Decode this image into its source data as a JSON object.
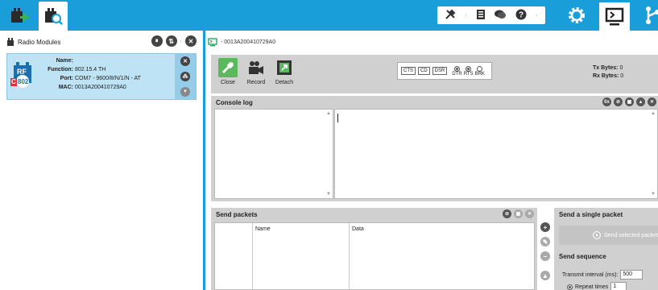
{
  "colors": {
    "accent": "#1a9ed9",
    "panel": "#d0d0d0",
    "card": "#bde3f5"
  },
  "left_panel": {
    "title": "Radio Modules",
    "module": {
      "name_label": "Name:",
      "name_value": "",
      "function_label": "Function:",
      "function_value": "802.15.4 TH",
      "port_label": "Port:",
      "port_value": "COM7 - 9600/8/N/1/N - AT",
      "mac_label": "MAC:",
      "mac_value": "0013A200410729A0",
      "badge_text": "802",
      "badge_letter": "C",
      "badge_top": "RF"
    }
  },
  "device_tab": {
    "label": "- 0013A200410729A0"
  },
  "connection": {
    "close_label": "Close",
    "record_label": "Record",
    "detach_label": "Detach",
    "signals": [
      "CTS",
      "CD",
      "DSR"
    ],
    "radio_labels": [
      "DTR",
      "RTS",
      "BRK"
    ],
    "tx_label": "Tx Bytes:",
    "tx_value": "0",
    "rx_label": "Rx Bytes:",
    "rx_value": "0"
  },
  "console_log": {
    "title": "Console log"
  },
  "send_packets": {
    "title": "Send packets",
    "columns": [
      "Name",
      "Data"
    ]
  },
  "single_packet": {
    "title": "Send a single packet",
    "button_label": "Send selected packet"
  },
  "sequence": {
    "title": "Send sequence",
    "interval_label": "Transmit interval (ms):",
    "interval_value": "500",
    "repeat_label": "Repeat times",
    "repeat_value": "1"
  }
}
